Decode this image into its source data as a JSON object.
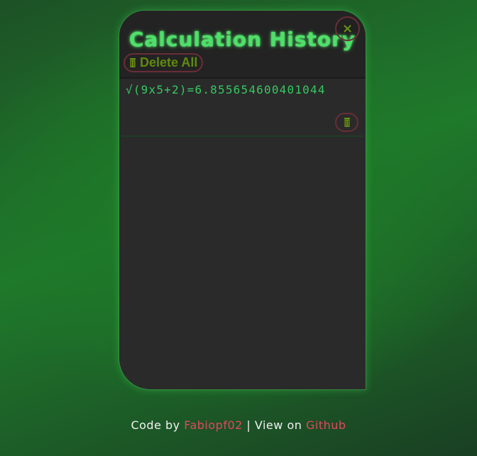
{
  "panel": {
    "title": "Calculation History",
    "close_symbol": "×",
    "close_icon": "close-icon",
    "delete_all_label": "Delete All",
    "delete_icon": "trash-icon",
    "accent_color": "#4fe06a",
    "button_text_color": "#5f8a0f",
    "button_border_color": "#6a2d37"
  },
  "history": [
    {
      "expression": "√(9x5+2)=6.855654600401044"
    }
  ],
  "footer": {
    "code_by_prefix": "Code by",
    "author": "Fabiopf02",
    "separator": "|",
    "view_on_prefix": "View on",
    "repo_link": "Github",
    "link_color": "#e0485e"
  }
}
